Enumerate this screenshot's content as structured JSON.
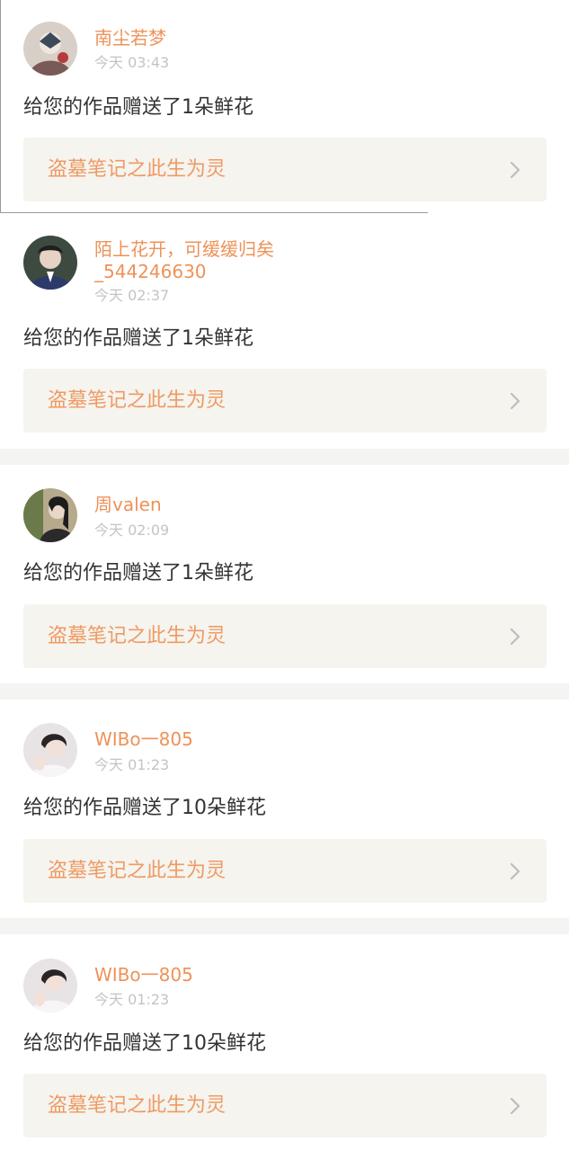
{
  "notifications": [
    {
      "username": "南尘若梦",
      "username_line2": "",
      "time": "今天 03:43",
      "message": "给您的作品赠送了1朵鲜花",
      "work_title": "盗墓笔记之此生为灵",
      "avatar_icon": "avatar-photo"
    },
    {
      "username": "陌上花开，可缓缓归矣",
      "username_line2": "_544246630",
      "time": "今天 02:37",
      "message": "给您的作品赠送了1朵鲜花",
      "work_title": "盗墓笔记之此生为灵",
      "avatar_icon": "avatar-photo"
    },
    {
      "username": "周valen",
      "username_line2": "",
      "time": "今天 02:09",
      "message": "给您的作品赠送了1朵鲜花",
      "work_title": "盗墓笔记之此生为灵",
      "avatar_icon": "avatar-photo"
    },
    {
      "username": "WIBo一805",
      "username_line2": "",
      "time": "今天 01:23",
      "message": "给您的作品赠送了10朵鲜花",
      "work_title": "盗墓笔记之此生为灵",
      "avatar_icon": "avatar-photo"
    },
    {
      "username": "WIBo一805",
      "username_line2": "",
      "time": "今天 01:23",
      "message": "给您的作品赠送了10朵鲜花",
      "work_title": "盗墓笔记之此生为灵",
      "avatar_icon": "avatar-photo"
    }
  ],
  "colors": {
    "username": "#ee9258",
    "time": "#c4c4c4",
    "message": "#333333",
    "work_title": "#ef9a63",
    "work_link_bg": "#f5f4ef",
    "gap_bg": "#f4f4f2",
    "chevron": "#bdbdbd"
  }
}
